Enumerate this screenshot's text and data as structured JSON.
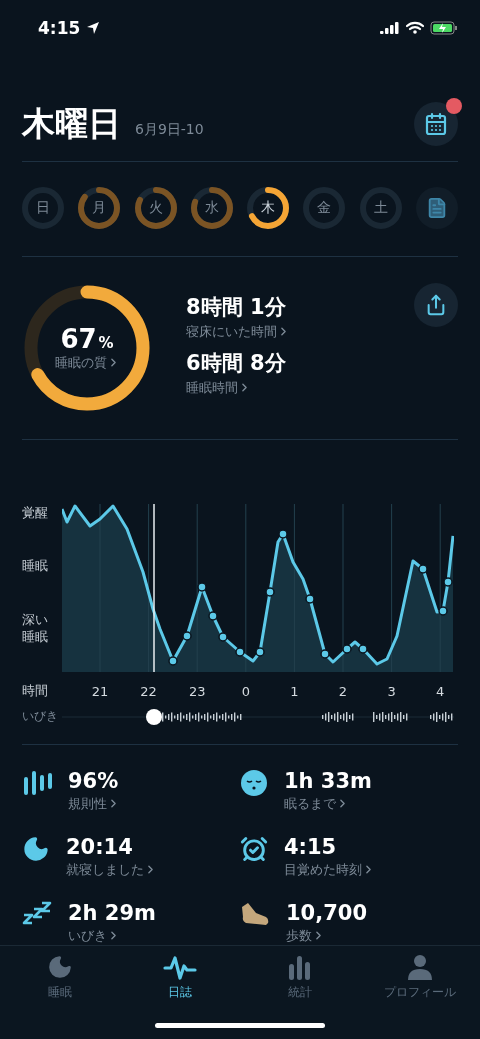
{
  "status_bar": {
    "time": "4:15"
  },
  "header": {
    "title": "木曜日",
    "date_range": "6月9日-10",
    "calendar_badge": true
  },
  "days": [
    {
      "label": "日",
      "selected": false
    },
    {
      "label": "月",
      "level": 0.85,
      "selected": false
    },
    {
      "label": "火",
      "level": 0.82,
      "selected": false
    },
    {
      "label": "水",
      "level": 0.8,
      "selected": false
    },
    {
      "label": "木",
      "level": 0.67,
      "selected": true
    },
    {
      "label": "金",
      "selected": false
    },
    {
      "label": "土",
      "selected": false
    }
  ],
  "summary": {
    "quality": {
      "value": "67",
      "unit": "%",
      "label": "睡眠の質",
      "level": 0.67
    },
    "metrics": [
      {
        "value": "8時間 1分",
        "label": "寝床にいた時間"
      },
      {
        "value": "6時間 8分",
        "label": "睡眠時間"
      }
    ]
  },
  "chart": {
    "y_labels": [
      "覚醒",
      "睡眠",
      "深い睡眠"
    ],
    "x_label": "時間",
    "x_ticks": [
      "21",
      "22",
      "23",
      "0",
      "1",
      "2",
      "3",
      "4"
    ],
    "snore_label": "いびき"
  },
  "stats": [
    {
      "kind": "regularity",
      "value": "96%",
      "label": "規則性"
    },
    {
      "kind": "fall_asleep",
      "value": "1h 33m",
      "label": "眠るまで"
    },
    {
      "kind": "bedtime",
      "value": "20:14",
      "label": "就寝しました"
    },
    {
      "kind": "wake",
      "value": "4:15",
      "label": "目覚めた時刻"
    },
    {
      "kind": "snore",
      "value": "2h 29m",
      "label": "いびき"
    },
    {
      "kind": "steps",
      "value": "10,700",
      "label": "歩数"
    }
  ],
  "tab_bar": [
    {
      "kind": "sleep",
      "label": "睡眠",
      "selected": false
    },
    {
      "kind": "journal",
      "label": "日誌",
      "selected": true
    },
    {
      "kind": "stats",
      "label": "統計",
      "selected": false
    },
    {
      "kind": "profile",
      "label": "プロフィール",
      "selected": false
    }
  ]
}
